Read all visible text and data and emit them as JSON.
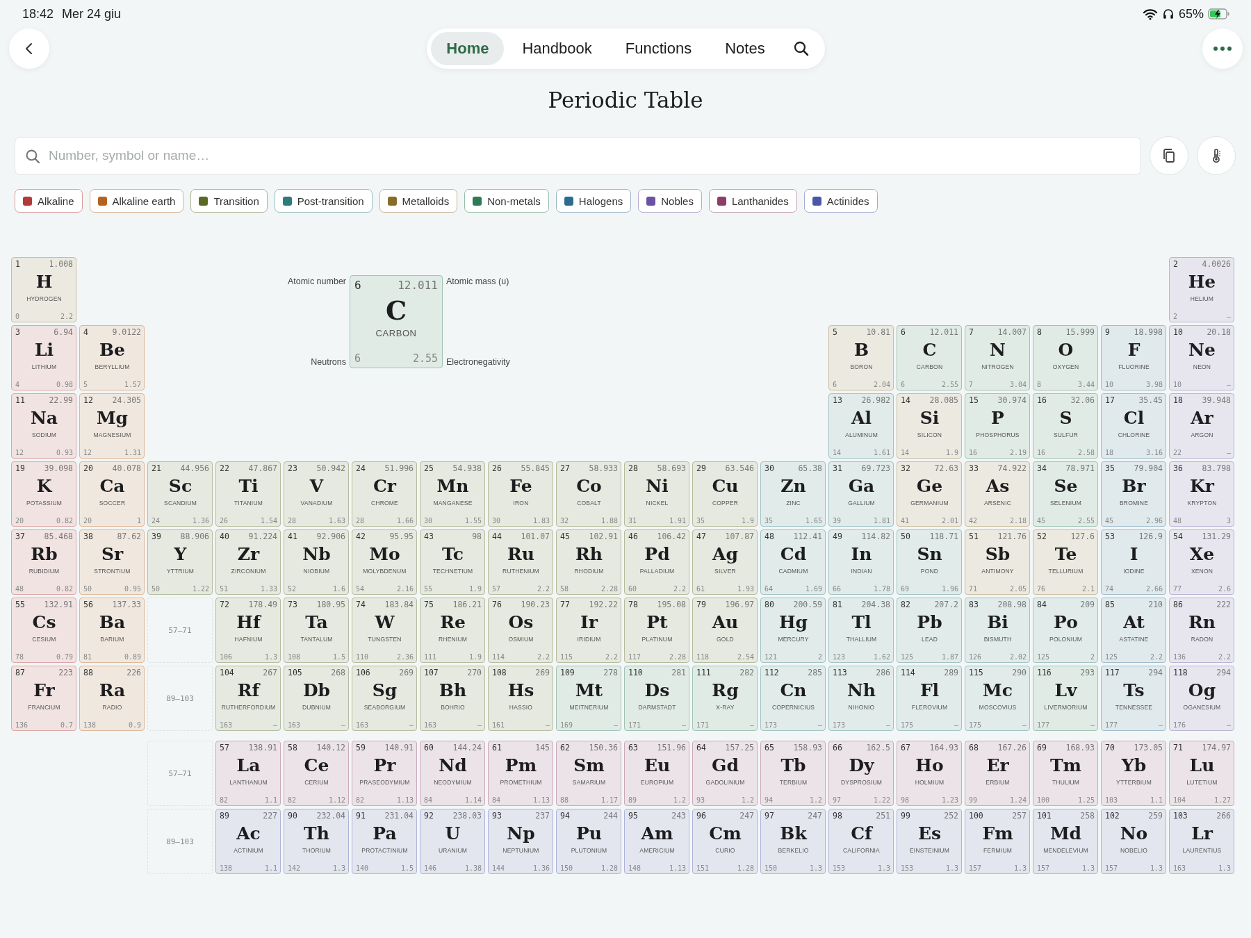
{
  "status_bar": {
    "time": "18:42",
    "date": "Mer 24 giu",
    "battery": "65%"
  },
  "nav": {
    "tabs": [
      {
        "label": "Home",
        "selected": true
      },
      {
        "label": "Handbook",
        "selected": false
      },
      {
        "label": "Functions",
        "selected": false
      },
      {
        "label": "Notes",
        "selected": false
      }
    ]
  },
  "title": "Periodic Table",
  "search": {
    "placeholder": "Number, symbol or name…"
  },
  "legend": [
    {
      "label": "Alkaline",
      "kind": "alkaline",
      "color": "#b23a3a"
    },
    {
      "label": "Alkaline earth",
      "kind": "alkaline_earth",
      "color": "#b5621f"
    },
    {
      "label": "Transition",
      "kind": "transition",
      "color": "#5a6a24"
    },
    {
      "label": "Post-transition",
      "kind": "post_transition",
      "color": "#2f7a7c"
    },
    {
      "label": "Metalloids",
      "kind": "metalloid",
      "color": "#8a6c2a"
    },
    {
      "label": "Non-metals",
      "kind": "nonmetal",
      "color": "#2f7a55"
    },
    {
      "label": "Halogens",
      "kind": "halogen",
      "color": "#2e6b90"
    },
    {
      "label": "Nobles",
      "kind": "noble",
      "color": "#6a52a3"
    },
    {
      "label": "Lanthanides",
      "kind": "lanthanide",
      "color": "#8c3e66"
    },
    {
      "label": "Actinides",
      "kind": "actinide",
      "color": "#4a56a8"
    }
  ],
  "key": {
    "number": "6",
    "symbol": "C",
    "name": "CARBON",
    "mass": "12.011",
    "neutrons": "6",
    "electronegativity": "2.55",
    "kind": "nonmetal",
    "number_label": "Atomic number",
    "mass_label": "Atomic mass (u)",
    "neutrons_label": "Neutrons",
    "electronegativity_label": "Electronegativity"
  },
  "table": {
    "rows": [
      {
        "cells": [
          {
            "kind": "metalloid",
            "number": "1",
            "symbol": "H",
            "name": "HYDROGEN",
            "mass": "1.008",
            "neutrons": "0",
            "electronegativity": "2.2"
          },
          {
            "kind": "blank"
          },
          {
            "kind": "blank"
          },
          {
            "kind": "blank"
          },
          {
            "kind": "blank"
          },
          {
            "kind": "blank"
          },
          {
            "kind": "blank"
          },
          {
            "kind": "blank"
          },
          {
            "kind": "blank"
          },
          {
            "kind": "blank"
          },
          {
            "kind": "blank"
          },
          {
            "kind": "blank"
          },
          {
            "kind": "blank"
          },
          {
            "kind": "blank"
          },
          {
            "kind": "blank"
          },
          {
            "kind": "blank"
          },
          {
            "kind": "blank"
          },
          {
            "kind": "noble",
            "number": "2",
            "symbol": "He",
            "name": "HELIUM",
            "mass": "4.0026",
            "neutrons": "2",
            "electronegativity": "–"
          }
        ]
      },
      {
        "cells": [
          {
            "kind": "alkaline",
            "number": "3",
            "symbol": "Li",
            "name": "LITHIUM",
            "mass": "6.94",
            "neutrons": "4",
            "electronegativity": "0.98"
          },
          {
            "kind": "alkaline_earth",
            "number": "4",
            "symbol": "Be",
            "name": "BERYLLIUM",
            "mass": "9.0122",
            "neutrons": "5",
            "electronegativity": "1.57"
          },
          {
            "kind": "blank"
          },
          {
            "kind": "blank"
          },
          {
            "kind": "blank"
          },
          {
            "kind": "blank"
          },
          {
            "kind": "blank"
          },
          {
            "kind": "blank"
          },
          {
            "kind": "blank"
          },
          {
            "kind": "blank"
          },
          {
            "kind": "blank"
          },
          {
            "kind": "blank"
          },
          {
            "kind": "metalloid",
            "number": "5",
            "symbol": "B",
            "name": "BORON",
            "mass": "10.81",
            "neutrons": "6",
            "electronegativity": "2.04"
          },
          {
            "kind": "nonmetal",
            "number": "6",
            "symbol": "C",
            "name": "CARBON",
            "mass": "12.011",
            "neutrons": "6",
            "electronegativity": "2.55"
          },
          {
            "kind": "nonmetal",
            "number": "7",
            "symbol": "N",
            "name": "NITROGEN",
            "mass": "14.007",
            "neutrons": "7",
            "electronegativity": "3.04"
          },
          {
            "kind": "nonmetal",
            "number": "8",
            "symbol": "O",
            "name": "OXYGEN",
            "mass": "15.999",
            "neutrons": "8",
            "electronegativity": "3.44"
          },
          {
            "kind": "halogen",
            "number": "9",
            "symbol": "F",
            "name": "FLUORINE",
            "mass": "18.998",
            "neutrons": "10",
            "electronegativity": "3.98"
          },
          {
            "kind": "noble",
            "number": "10",
            "symbol": "Ne",
            "name": "NEON",
            "mass": "20.18",
            "neutrons": "10",
            "electronegativity": "–"
          }
        ]
      },
      {
        "cells": [
          {
            "kind": "alkaline",
            "number": "11",
            "symbol": "Na",
            "name": "SODIUM",
            "mass": "22.99",
            "neutrons": "12",
            "electronegativity": "0.93"
          },
          {
            "kind": "alkaline_earth",
            "number": "12",
            "symbol": "Mg",
            "name": "MAGNESIUM",
            "mass": "24.305",
            "neutrons": "12",
            "electronegativity": "1.31"
          },
          {
            "kind": "blank"
          },
          {
            "kind": "blank"
          },
          {
            "kind": "blank"
          },
          {
            "kind": "blank"
          },
          {
            "kind": "blank"
          },
          {
            "kind": "blank"
          },
          {
            "kind": "blank"
          },
          {
            "kind": "blank"
          },
          {
            "kind": "blank"
          },
          {
            "kind": "blank"
          },
          {
            "kind": "post_transition",
            "number": "13",
            "symbol": "Al",
            "name": "ALUMINUM",
            "mass": "26.982",
            "neutrons": "14",
            "electronegativity": "1.61"
          },
          {
            "kind": "metalloid",
            "number": "14",
            "symbol": "Si",
            "name": "SILICON",
            "mass": "28.085",
            "neutrons": "14",
            "electronegativity": "1.9"
          },
          {
            "kind": "nonmetal",
            "number": "15",
            "symbol": "P",
            "name": "PHOSPHORUS",
            "mass": "30.974",
            "neutrons": "16",
            "electronegativity": "2.19"
          },
          {
            "kind": "nonmetal",
            "number": "16",
            "symbol": "S",
            "name": "SULFUR",
            "mass": "32.06",
            "neutrons": "16",
            "electronegativity": "2.58"
          },
          {
            "kind": "halogen",
            "number": "17",
            "symbol": "Cl",
            "name": "CHLORINE",
            "mass": "35.45",
            "neutrons": "18",
            "electronegativity": "3.16"
          },
          {
            "kind": "noble",
            "number": "18",
            "symbol": "Ar",
            "name": "ARGON",
            "mass": "39.948",
            "neutrons": "22",
            "electronegativity": "–"
          }
        ]
      },
      {
        "cells": [
          {
            "kind": "alkaline",
            "number": "19",
            "symbol": "K",
            "name": "POTASSIUM",
            "mass": "39.098",
            "neutrons": "20",
            "electronegativity": "0.82"
          },
          {
            "kind": "alkaline_earth",
            "number": "20",
            "symbol": "Ca",
            "name": "SOCCER",
            "mass": "40.078",
            "neutrons": "20",
            "electronegativity": "1"
          },
          {
            "kind": "transition",
            "number": "21",
            "symbol": "Sc",
            "name": "SCANDIUM",
            "mass": "44.956",
            "neutrons": "24",
            "electronegativity": "1.36"
          },
          {
            "kind": "transition",
            "number": "22",
            "symbol": "Ti",
            "name": "TITANIUM",
            "mass": "47.867",
            "neutrons": "26",
            "electronegativity": "1.54"
          },
          {
            "kind": "transition",
            "number": "23",
            "symbol": "V",
            "name": "VANADIUM",
            "mass": "50.942",
            "neutrons": "28",
            "electronegativity": "1.63"
          },
          {
            "kind": "transition",
            "number": "24",
            "symbol": "Cr",
            "name": "CHROME",
            "mass": "51.996",
            "neutrons": "28",
            "electronegativity": "1.66"
          },
          {
            "kind": "transition",
            "number": "25",
            "symbol": "Mn",
            "name": "MANGANESE",
            "mass": "54.938",
            "neutrons": "30",
            "electronegativity": "1.55"
          },
          {
            "kind": "transition",
            "number": "26",
            "symbol": "Fe",
            "name": "IRON",
            "mass": "55.845",
            "neutrons": "30",
            "electronegativity": "1.83"
          },
          {
            "kind": "transition",
            "number": "27",
            "symbol": "Co",
            "name": "COBALT",
            "mass": "58.933",
            "neutrons": "32",
            "electronegativity": "1.88"
          },
          {
            "kind": "transition",
            "number": "28",
            "symbol": "Ni",
            "name": "NICKEL",
            "mass": "58.693",
            "neutrons": "31",
            "electronegativity": "1.91"
          },
          {
            "kind": "transition",
            "number": "29",
            "symbol": "Cu",
            "name": "COPPER",
            "mass": "63.546",
            "neutrons": "35",
            "electronegativity": "1.9"
          },
          {
            "kind": "post_transition",
            "number": "30",
            "symbol": "Zn",
            "name": "ZINC",
            "mass": "65.38",
            "neutrons": "35",
            "electronegativity": "1.65"
          },
          {
            "kind": "post_transition",
            "number": "31",
            "symbol": "Ga",
            "name": "GALLIUM",
            "mass": "69.723",
            "neutrons": "39",
            "electronegativity": "1.81"
          },
          {
            "kind": "metalloid",
            "number": "32",
            "symbol": "Ge",
            "name": "GERMANIUM",
            "mass": "72.63",
            "neutrons": "41",
            "electronegativity": "2.01"
          },
          {
            "kind": "metalloid",
            "number": "33",
            "symbol": "As",
            "name": "ARSENIC",
            "mass": "74.922",
            "neutrons": "42",
            "electronegativity": "2.18"
          },
          {
            "kind": "nonmetal",
            "number": "34",
            "symbol": "Se",
            "name": "SELENIUM",
            "mass": "78.971",
            "neutrons": "45",
            "electronegativity": "2.55"
          },
          {
            "kind": "halogen",
            "number": "35",
            "symbol": "Br",
            "name": "BROMINE",
            "mass": "79.904",
            "neutrons": "45",
            "electronegativity": "2.96"
          },
          {
            "kind": "noble",
            "number": "36",
            "symbol": "Kr",
            "name": "KRYPTON",
            "mass": "83.798",
            "neutrons": "48",
            "electronegativity": "3"
          }
        ]
      },
      {
        "cells": [
          {
            "kind": "alkaline",
            "number": "37",
            "symbol": "Rb",
            "name": "RUBIDIUM",
            "mass": "85.468",
            "neutrons": "48",
            "electronegativity": "0.82"
          },
          {
            "kind": "alkaline_earth",
            "number": "38",
            "symbol": "Sr",
            "name": "STRONTIUM",
            "mass": "87.62",
            "neutrons": "50",
            "electronegativity": "0.95"
          },
          {
            "kind": "transition",
            "number": "39",
            "symbol": "Y",
            "name": "YTTRIUM",
            "mass": "88.906",
            "neutrons": "50",
            "electronegativity": "1.22"
          },
          {
            "kind": "transition",
            "number": "40",
            "symbol": "Zr",
            "name": "ZIRCONIUM",
            "mass": "91.224",
            "neutrons": "51",
            "electronegativity": "1.33"
          },
          {
            "kind": "transition",
            "number": "41",
            "symbol": "Nb",
            "name": "NIOBIUM",
            "mass": "92.906",
            "neutrons": "52",
            "electronegativity": "1.6"
          },
          {
            "kind": "transition",
            "number": "42",
            "symbol": "Mo",
            "name": "MOLYBDENUM",
            "mass": "95.95",
            "neutrons": "54",
            "electronegativity": "2.16"
          },
          {
            "kind": "transition",
            "number": "43",
            "symbol": "Tc",
            "name": "TECHNETIUM",
            "mass": "98",
            "neutrons": "55",
            "electronegativity": "1.9"
          },
          {
            "kind": "transition",
            "number": "44",
            "symbol": "Ru",
            "name": "RUTHENIUM",
            "mass": "101.07",
            "neutrons": "57",
            "electronegativity": "2.2"
          },
          {
            "kind": "transition",
            "number": "45",
            "symbol": "Rh",
            "name": "RHODIUM",
            "mass": "102.91",
            "neutrons": "58",
            "electronegativity": "2.28"
          },
          {
            "kind": "transition",
            "number": "46",
            "symbol": "Pd",
            "name": "PALLADIUM",
            "mass": "106.42",
            "neutrons": "60",
            "electronegativity": "2.2"
          },
          {
            "kind": "transition",
            "number": "47",
            "symbol": "Ag",
            "name": "SILVER",
            "mass": "107.87",
            "neutrons": "61",
            "electronegativity": "1.93"
          },
          {
            "kind": "post_transition",
            "number": "48",
            "symbol": "Cd",
            "name": "CADMIUM",
            "mass": "112.41",
            "neutrons": "64",
            "electronegativity": "1.69"
          },
          {
            "kind": "post_transition",
            "number": "49",
            "symbol": "In",
            "name": "INDIAN",
            "mass": "114.82",
            "neutrons": "66",
            "electronegativity": "1.78"
          },
          {
            "kind": "post_transition",
            "number": "50",
            "symbol": "Sn",
            "name": "POND",
            "mass": "118.71",
            "neutrons": "69",
            "electronegativity": "1.96"
          },
          {
            "kind": "metalloid",
            "number": "51",
            "symbol": "Sb",
            "name": "ANTIMONY",
            "mass": "121.76",
            "neutrons": "71",
            "electronegativity": "2.05"
          },
          {
            "kind": "metalloid",
            "number": "52",
            "symbol": "Te",
            "name": "TELLURIUM",
            "mass": "127.6",
            "neutrons": "76",
            "electronegativity": "2.1"
          },
          {
            "kind": "halogen",
            "number": "53",
            "symbol": "I",
            "name": "IODINE",
            "mass": "126.9",
            "neutrons": "74",
            "electronegativity": "2.66"
          },
          {
            "kind": "noble",
            "number": "54",
            "symbol": "Xe",
            "name": "XENON",
            "mass": "131.29",
            "neutrons": "77",
            "electronegativity": "2.6"
          }
        ]
      },
      {
        "cells": [
          {
            "kind": "alkaline",
            "number": "55",
            "symbol": "Cs",
            "name": "CESIUM",
            "mass": "132.91",
            "neutrons": "78",
            "electronegativity": "0.79"
          },
          {
            "kind": "alkaline_earth",
            "number": "56",
            "symbol": "Ba",
            "name": "BARIUM",
            "mass": "137.33",
            "neutrons": "81",
            "electronegativity": "0.89"
          },
          {
            "kind": "range",
            "label": "57–71"
          },
          {
            "kind": "transition",
            "number": "72",
            "symbol": "Hf",
            "name": "HAFNIUM",
            "mass": "178.49",
            "neutrons": "106",
            "electronegativity": "1.3"
          },
          {
            "kind": "transition",
            "number": "73",
            "symbol": "Ta",
            "name": "TANTALUM",
            "mass": "180.95",
            "neutrons": "108",
            "electronegativity": "1.5"
          },
          {
            "kind": "transition",
            "number": "74",
            "symbol": "W",
            "name": "TUNGSTEN",
            "mass": "183.84",
            "neutrons": "110",
            "electronegativity": "2.36"
          },
          {
            "kind": "transition",
            "number": "75",
            "symbol": "Re",
            "name": "RHENIUM",
            "mass": "186.21",
            "neutrons": "111",
            "electronegativity": "1.9"
          },
          {
            "kind": "transition",
            "number": "76",
            "symbol": "Os",
            "name": "OSMIUM",
            "mass": "190.23",
            "neutrons": "114",
            "electronegativity": "2.2"
          },
          {
            "kind": "transition",
            "number": "77",
            "symbol": "Ir",
            "name": "IRIDIUM",
            "mass": "192.22",
            "neutrons": "115",
            "electronegativity": "2.2"
          },
          {
            "kind": "transition",
            "number": "78",
            "symbol": "Pt",
            "name": "PLATINUM",
            "mass": "195.08",
            "neutrons": "117",
            "electronegativity": "2.28"
          },
          {
            "kind": "transition",
            "number": "79",
            "symbol": "Au",
            "name": "GOLD",
            "mass": "196.97",
            "neutrons": "118",
            "electronegativity": "2.54"
          },
          {
            "kind": "post_transition",
            "number": "80",
            "symbol": "Hg",
            "name": "MERCURY",
            "mass": "200.59",
            "neutrons": "121",
            "electronegativity": "2"
          },
          {
            "kind": "post_transition",
            "number": "81",
            "symbol": "Tl",
            "name": "THALLIUM",
            "mass": "204.38",
            "neutrons": "123",
            "electronegativity": "1.62"
          },
          {
            "kind": "post_transition",
            "number": "82",
            "symbol": "Pb",
            "name": "LEAD",
            "mass": "207.2",
            "neutrons": "125",
            "electronegativity": "1.87"
          },
          {
            "kind": "post_transition",
            "number": "83",
            "symbol": "Bi",
            "name": "BISMUTH",
            "mass": "208.98",
            "neutrons": "126",
            "electronegativity": "2.02"
          },
          {
            "kind": "post_transition",
            "number": "84",
            "symbol": "Po",
            "name": "POLONIUM",
            "mass": "209",
            "neutrons": "125",
            "electronegativity": "2"
          },
          {
            "kind": "halogen",
            "number": "85",
            "symbol": "At",
            "name": "ASTATINE",
            "mass": "210",
            "neutrons": "125",
            "electronegativity": "2.2"
          },
          {
            "kind": "noble",
            "number": "86",
            "symbol": "Rn",
            "name": "RADON",
            "mass": "222",
            "neutrons": "136",
            "electronegativity": "2.2"
          }
        ]
      },
      {
        "cells": [
          {
            "kind": "alkaline",
            "number": "87",
            "symbol": "Fr",
            "name": "FRANCIUM",
            "mass": "223",
            "neutrons": "136",
            "electronegativity": "0.7"
          },
          {
            "kind": "alkaline_earth",
            "number": "88",
            "symbol": "Ra",
            "name": "RADIO",
            "mass": "226",
            "neutrons": "138",
            "electronegativity": "0.9"
          },
          {
            "kind": "range",
            "label": "89–103"
          },
          {
            "kind": "transition",
            "number": "104",
            "symbol": "Rf",
            "name": "RUTHERFORDIUM",
            "mass": "267",
            "neutrons": "163",
            "electronegativity": "–"
          },
          {
            "kind": "transition",
            "number": "105",
            "symbol": "Db",
            "name": "DUBNIUM",
            "mass": "268",
            "neutrons": "163",
            "electronegativity": "–"
          },
          {
            "kind": "transition",
            "number": "106",
            "symbol": "Sg",
            "name": "SEABORGIUM",
            "mass": "269",
            "neutrons": "163",
            "electronegativity": "–"
          },
          {
            "kind": "transition",
            "number": "107",
            "symbol": "Bh",
            "name": "BOHRIO",
            "mass": "270",
            "neutrons": "163",
            "electronegativity": "–"
          },
          {
            "kind": "transition",
            "number": "108",
            "symbol": "Hs",
            "name": "HASSIO",
            "mass": "269",
            "neutrons": "161",
            "electronegativity": "–"
          },
          {
            "kind": "nonmetal",
            "number": "109",
            "symbol": "Mt",
            "name": "MEITNERIUM",
            "mass": "278",
            "neutrons": "169",
            "electronegativity": "–"
          },
          {
            "kind": "nonmetal",
            "number": "110",
            "symbol": "Ds",
            "name": "DARMSTADT",
            "mass": "281",
            "neutrons": "171",
            "electronegativity": "–"
          },
          {
            "kind": "nonmetal",
            "number": "111",
            "symbol": "Rg",
            "name": "X-RAY",
            "mass": "282",
            "neutrons": "171",
            "electronegativity": "–"
          },
          {
            "kind": "post_transition",
            "number": "112",
            "symbol": "Cn",
            "name": "COPERNICIUS",
            "mass": "285",
            "neutrons": "173",
            "electronegativity": "–"
          },
          {
            "kind": "post_transition",
            "number": "113",
            "symbol": "Nh",
            "name": "NIHONIO",
            "mass": "286",
            "neutrons": "173",
            "electronegativity": "–"
          },
          {
            "kind": "post_transition",
            "number": "114",
            "symbol": "Fl",
            "name": "FLEROVIUM",
            "mass": "289",
            "neutrons": "175",
            "electronegativity": "–"
          },
          {
            "kind": "post_transition",
            "number": "115",
            "symbol": "Mc",
            "name": "MOSCOVIUS",
            "mass": "290",
            "neutrons": "175",
            "electronegativity": "–"
          },
          {
            "kind": "nonmetal",
            "number": "116",
            "symbol": "Lv",
            "name": "LIVERMORIUM",
            "mass": "293",
            "neutrons": "177",
            "electronegativity": "–"
          },
          {
            "kind": "halogen",
            "number": "117",
            "symbol": "Ts",
            "name": "TENNESSEE",
            "mass": "294",
            "neutrons": "177",
            "electronegativity": "–"
          },
          {
            "kind": "noble",
            "number": "118",
            "symbol": "Og",
            "name": "OGANESIUM",
            "mass": "294",
            "neutrons": "176",
            "electronegativity": "–"
          }
        ]
      }
    ]
  },
  "series": {
    "rows": [
      {
        "cells": [
          {
            "kind": "blank"
          },
          {
            "kind": "blank"
          },
          {
            "kind": "range",
            "label": "57–71"
          },
          {
            "kind": "lanthanide",
            "number": "57",
            "symbol": "La",
            "name": "LANTHANUM",
            "mass": "138.91",
            "neutrons": "82",
            "electronegativity": "1.1"
          },
          {
            "kind": "lanthanide",
            "number": "58",
            "symbol": "Ce",
            "name": "CERIUM",
            "mass": "140.12",
            "neutrons": "82",
            "electronegativity": "1.12"
          },
          {
            "kind": "lanthanide",
            "number": "59",
            "symbol": "Pr",
            "name": "PRASEODYMIUM",
            "mass": "140.91",
            "neutrons": "82",
            "electronegativity": "1.13"
          },
          {
            "kind": "lanthanide",
            "number": "60",
            "symbol": "Nd",
            "name": "NEODYMIUM",
            "mass": "144.24",
            "neutrons": "84",
            "electronegativity": "1.14"
          },
          {
            "kind": "lanthanide",
            "number": "61",
            "symbol": "Pm",
            "name": "PROMETHIUM",
            "mass": "145",
            "neutrons": "84",
            "electronegativity": "1.13"
          },
          {
            "kind": "lanthanide",
            "number": "62",
            "symbol": "Sm",
            "name": "SAMARIUM",
            "mass": "150.36",
            "neutrons": "88",
            "electronegativity": "1.17"
          },
          {
            "kind": "lanthanide",
            "number": "63",
            "symbol": "Eu",
            "name": "EUROPIUM",
            "mass": "151.96",
            "neutrons": "89",
            "electronegativity": "1.2"
          },
          {
            "kind": "lanthanide",
            "number": "64",
            "symbol": "Gd",
            "name": "GADOLINIUM",
            "mass": "157.25",
            "neutrons": "93",
            "electronegativity": "1.2"
          },
          {
            "kind": "lanthanide",
            "number": "65",
            "symbol": "Tb",
            "name": "TERBIUM",
            "mass": "158.93",
            "neutrons": "94",
            "electronegativity": "1.2"
          },
          {
            "kind": "lanthanide",
            "number": "66",
            "symbol": "Dy",
            "name": "DYSPROSIUM",
            "mass": "162.5",
            "neutrons": "97",
            "electronegativity": "1.22"
          },
          {
            "kind": "lanthanide",
            "number": "67",
            "symbol": "Ho",
            "name": "HOLMIUM",
            "mass": "164.93",
            "neutrons": "98",
            "electronegativity": "1.23"
          },
          {
            "kind": "lanthanide",
            "number": "68",
            "symbol": "Er",
            "name": "ERBIUM",
            "mass": "167.26",
            "neutrons": "99",
            "electronegativity": "1.24"
          },
          {
            "kind": "lanthanide",
            "number": "69",
            "symbol": "Tm",
            "name": "THULIUM",
            "mass": "168.93",
            "neutrons": "100",
            "electronegativity": "1.25"
          },
          {
            "kind": "lanthanide",
            "number": "70",
            "symbol": "Yb",
            "name": "YTTERBIUM",
            "mass": "173.05",
            "neutrons": "103",
            "electronegativity": "1.1"
          },
          {
            "kind": "lanthanide",
            "number": "71",
            "symbol": "Lu",
            "name": "LUTETIUM",
            "mass": "174.97",
            "neutrons": "104",
            "electronegativity": "1.27"
          }
        ]
      },
      {
        "cells": [
          {
            "kind": "blank"
          },
          {
            "kind": "blank"
          },
          {
            "kind": "range",
            "label": "89–103"
          },
          {
            "kind": "actinide",
            "number": "89",
            "symbol": "Ac",
            "name": "ACTINIUM",
            "mass": "227",
            "neutrons": "138",
            "electronegativity": "1.1"
          },
          {
            "kind": "actinide",
            "number": "90",
            "symbol": "Th",
            "name": "THORIUM",
            "mass": "232.04",
            "neutrons": "142",
            "electronegativity": "1.3"
          },
          {
            "kind": "actinide",
            "number": "91",
            "symbol": "Pa",
            "name": "PROTACTINIUM",
            "mass": "231.04",
            "neutrons": "140",
            "electronegativity": "1.5"
          },
          {
            "kind": "actinide",
            "number": "92",
            "symbol": "U",
            "name": "URANIUM",
            "mass": "238.03",
            "neutrons": "146",
            "electronegativity": "1.38"
          },
          {
            "kind": "actinide",
            "number": "93",
            "symbol": "Np",
            "name": "NEPTUNIUM",
            "mass": "237",
            "neutrons": "144",
            "electronegativity": "1.36"
          },
          {
            "kind": "actinide",
            "number": "94",
            "symbol": "Pu",
            "name": "PLUTONIUM",
            "mass": "244",
            "neutrons": "150",
            "electronegativity": "1.28"
          },
          {
            "kind": "actinide",
            "number": "95",
            "symbol": "Am",
            "name": "AMERICIUM",
            "mass": "243",
            "neutrons": "148",
            "electronegativity": "1.13"
          },
          {
            "kind": "actinide",
            "number": "96",
            "symbol": "Cm",
            "name": "CURIO",
            "mass": "247",
            "neutrons": "151",
            "electronegativity": "1.28"
          },
          {
            "kind": "actinide",
            "number": "97",
            "symbol": "Bk",
            "name": "BERKELIO",
            "mass": "247",
            "neutrons": "150",
            "electronegativity": "1.3"
          },
          {
            "kind": "actinide",
            "number": "98",
            "symbol": "Cf",
            "name": "CALIFORNIA",
            "mass": "251",
            "neutrons": "153",
            "electronegativity": "1.3"
          },
          {
            "kind": "actinide",
            "number": "99",
            "symbol": "Es",
            "name": "EINSTEINIUM",
            "mass": "252",
            "neutrons": "153",
            "electronegativity": "1.3"
          },
          {
            "kind": "actinide",
            "number": "100",
            "symbol": "Fm",
            "name": "FERMIUM",
            "mass": "257",
            "neutrons": "157",
            "electronegativity": "1.3"
          },
          {
            "kind": "actinide",
            "number": "101",
            "symbol": "Md",
            "name": "MENDELEVIUM",
            "mass": "258",
            "neutrons": "157",
            "electronegativity": "1.3"
          },
          {
            "kind": "actinide",
            "number": "102",
            "symbol": "No",
            "name": "NOBELIO",
            "mass": "259",
            "neutrons": "157",
            "electronegativity": "1.3"
          },
          {
            "kind": "actinide",
            "number": "103",
            "symbol": "Lr",
            "name": "LAURENTIUS",
            "mass": "266",
            "neutrons": "163",
            "electronegativity": "1.3"
          }
        ]
      }
    ]
  }
}
